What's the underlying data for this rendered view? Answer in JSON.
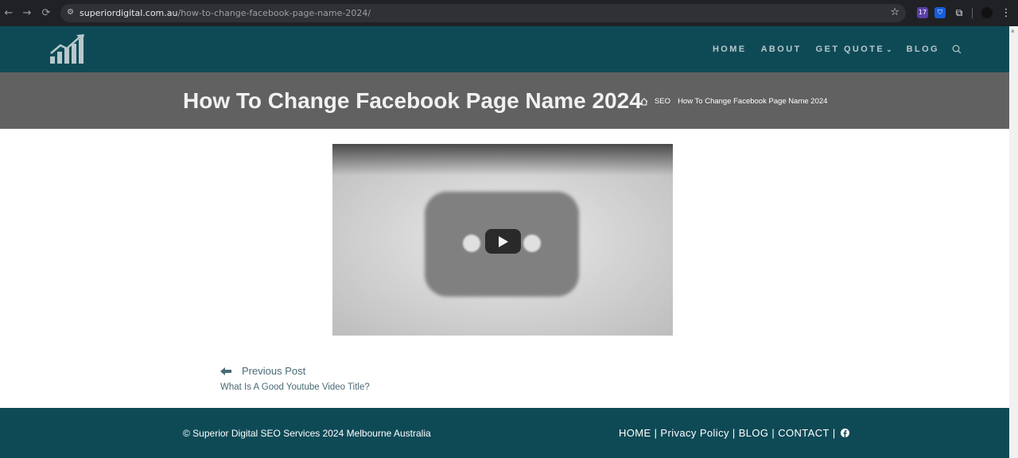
{
  "browser": {
    "url_host": "superiordigital.com.au",
    "url_path": "/how-to-change-facebook-page-name-2024/",
    "extension_badge": "17"
  },
  "header": {
    "nav": [
      {
        "label": "HOME"
      },
      {
        "label": "ABOUT"
      },
      {
        "label": "GET QUOTE"
      },
      {
        "label": "BLOG"
      }
    ]
  },
  "title_bar": {
    "title": "How To Change Facebook Page Name 2024",
    "breadcrumb": [
      "SEO",
      "How To Change Facebook Page Name 2024"
    ]
  },
  "post_nav": {
    "prev_label": "Previous Post",
    "prev_title": "What Is A Good Youtube Video Title?"
  },
  "footer": {
    "copyright": "© Superior Digital SEO Services 2024 Melbourne Australia",
    "links": [
      {
        "label": "HOME"
      },
      {
        "label": "Privacy Policy"
      },
      {
        "label": "BLOG"
      },
      {
        "label": "CONTACT"
      }
    ],
    "separator": "|"
  },
  "colors": {
    "header_bg": "#0e4a56",
    "title_bar_bg": "#616161",
    "footer_bg": "#0e4a56",
    "link_color": "#4a6a75"
  }
}
